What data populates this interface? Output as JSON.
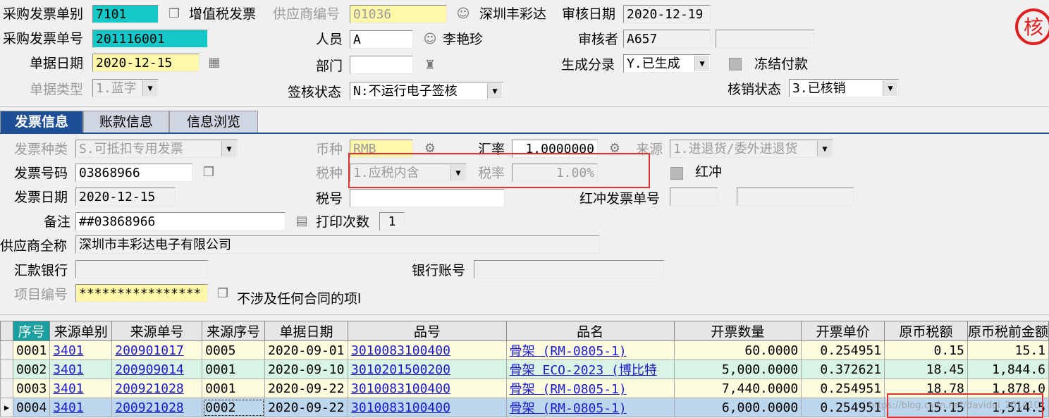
{
  "header": {
    "invoice_type_label": "采购发票单别",
    "invoice_type_value": "7101",
    "vat_label": "增值税发票",
    "supplier_code_label": "供应商编号",
    "supplier_code_value": "01036",
    "supplier_name": "深圳丰彩达",
    "audit_date_label": "审核日期",
    "audit_date_value": "2020-12-19",
    "invoice_no_label": "采购发票单号",
    "invoice_no_value": "201116001",
    "person_label": "人员",
    "person_value": "A",
    "person_name": "李艳珍",
    "auditor_label": "审核者",
    "auditor_value": "A657",
    "doc_date_label": "单据日期",
    "doc_date_value": "2020-12-15",
    "dept_label": "部门",
    "dept_value": "",
    "gen_label": "生成分录",
    "gen_value": "Y.已生成",
    "freeze_label": "冻结付款",
    "doc_type_label": "单据类型",
    "doc_type_value": "1.蓝字",
    "sign_label": "签核状态",
    "sign_value": "N:不运行电子签核",
    "verify_label": "核销状态",
    "verify_value": "3.已核销",
    "stamp_char": "核"
  },
  "tabs": [
    {
      "label": "发票信息"
    },
    {
      "label": "账款信息"
    },
    {
      "label": "信息浏览"
    }
  ],
  "form": {
    "kind_label": "发票种类",
    "kind_value": "S.可抵扣专用发票",
    "currency_label": "币种",
    "currency_value": "RMB",
    "rate_label": "汇率",
    "rate_value": "1.0000000",
    "source_label": "来源",
    "source_value": "1.进退货/委外进退货",
    "number_label": "发票号码",
    "number_value": "03868966",
    "tax_kind_label": "税种",
    "tax_kind_value": "1.应税内含",
    "tax_rate_label": "税率",
    "tax_rate_value": "1.00%",
    "red_label": "红冲",
    "date_label": "发票日期",
    "date_value": "2020-12-15",
    "tax_no_label": "税号",
    "tax_no_value": "",
    "red_no_label": "红冲发票单号",
    "remark_label": "备注",
    "remark_value": "##03868966",
    "print_label": "打印次数",
    "print_value": "1",
    "supplier_full_label": "供应商全称",
    "supplier_full_value": "深圳市丰彩达电子有限公司",
    "bank_label": "汇款银行",
    "bank_value": "",
    "account_label": "银行账号",
    "account_value": "",
    "project_label": "项目编号",
    "project_value": "****************",
    "contract_label": "不涉及任何合同的项l"
  },
  "grid": {
    "columns": [
      "序号",
      "来源单别",
      "来源单号",
      "来源序号",
      "单据日期",
      "品号",
      "品名",
      "开票数量",
      "开票单价",
      "原币税额",
      "原币税前金额"
    ],
    "rows": [
      [
        "0001",
        "3401",
        "200901017",
        "0005",
        "2020-09-01",
        "3010083100400",
        "骨架 (RM-0805-1)",
        "60.0000",
        "0.254951",
        "0.15",
        "15.1"
      ],
      [
        "0002",
        "3401",
        "200909014",
        "0001",
        "2020-09-10",
        "3010201500200",
        "骨架  ECO-2023 (博比特",
        "5,000.0000",
        "0.372621",
        "18.45",
        "1,844.6"
      ],
      [
        "0003",
        "3401",
        "200921028",
        "0001",
        "2020-09-22",
        "3010083100400",
        "骨架 (RM-0805-1)",
        "7,440.0000",
        "0.254951",
        "18.78",
        "1,878.0"
      ],
      [
        "0004",
        "3401",
        "200921028",
        "0002",
        "2020-09-22",
        "3010083100400",
        "骨架 (RM-0805-1)",
        "6,000.0000",
        "0.254951",
        "15.15",
        "1,514.5"
      ]
    ]
  },
  "watermark": "https://blog.csdn.net/davidqi_201410"
}
